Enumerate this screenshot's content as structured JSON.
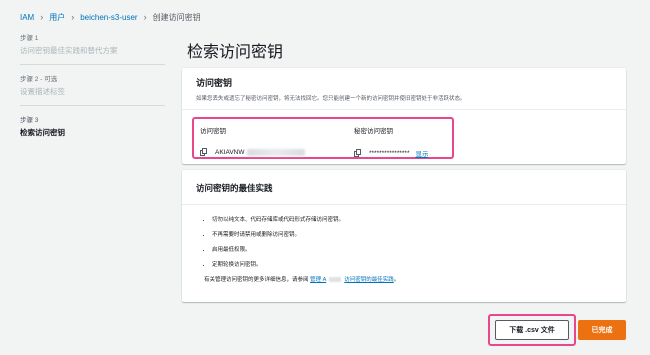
{
  "breadcrumb": {
    "items": [
      "IAM",
      "用户",
      "beichen-s3-user"
    ],
    "current": "创建访问密钥"
  },
  "steps": [
    {
      "number": "步骤 1",
      "name": "访问密钥最佳实践和替代方案"
    },
    {
      "number": "步骤 2 - 可选",
      "name": "设置描述标签"
    },
    {
      "number": "步骤 3",
      "name": "检索访问密钥"
    }
  ],
  "page": {
    "title": "检索访问密钥"
  },
  "access_key_card": {
    "title": "访问密钥",
    "description": "如果您丢失或遗忘了秘密访问密钥，将无法找回它。您只能创建一个新的访问密钥并使旧密钥处于非活跃状态。",
    "access_key_label": "访问密钥",
    "access_key_value": "AKIAVNW",
    "secret_key_label": "秘密访问密钥",
    "secret_key_value": "****************",
    "show_label": "显示"
  },
  "best_practices_card": {
    "title": "访问密钥的最佳实践",
    "items": [
      "切勿以纯文本、代码存储库或代码形式存储访问密钥。",
      "不再需要时请禁用或删除访问密钥。",
      "启用最低权限。",
      "定期轮换访问密钥。"
    ],
    "footer_prefix": "有关管理访问密钥的更多详细信息，请参阅",
    "footer_link_a": "管理 A",
    "footer_link_b": "访问密钥的最佳实践",
    "footer_suffix": "。"
  },
  "actions": {
    "download_label": "下载 .csv 文件",
    "done_label": "已完成"
  },
  "colors": {
    "accent": "#ec7211",
    "link": "#0073bb",
    "highlight": "#e8478b"
  }
}
